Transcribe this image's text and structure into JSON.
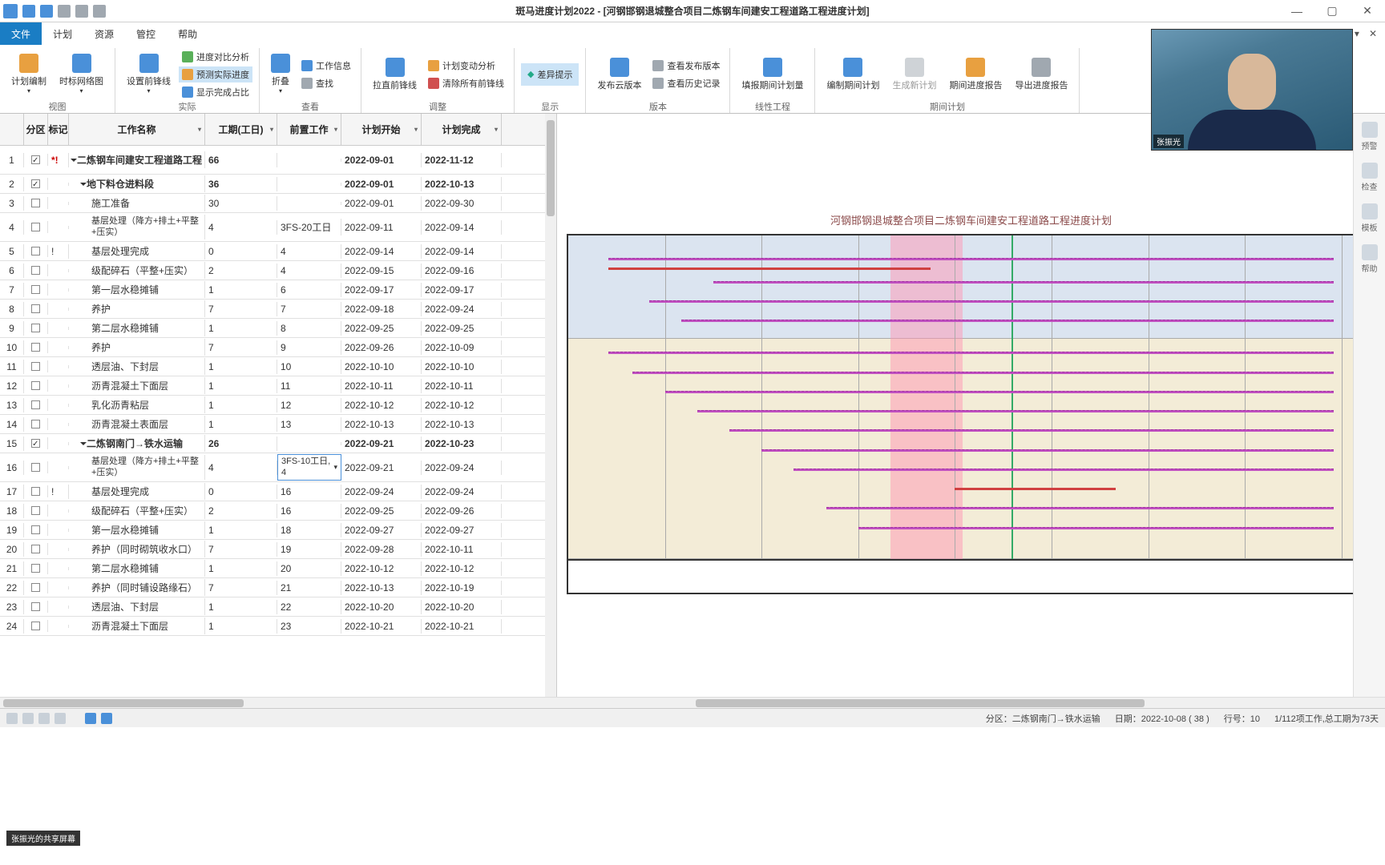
{
  "title": "斑马进度计划2022 - [河钢邯钢退城整合项目二炼钢车间建安工程道路工程进度计划]",
  "menu": {
    "file": "文件",
    "plan": "计划",
    "resource": "资源",
    "control": "管控",
    "help": "帮助"
  },
  "ribbon": {
    "g_view": "视图",
    "g_actual": "实际",
    "g_check": "查看",
    "g_adjust": "调整",
    "g_display": "显示",
    "g_version": "版本",
    "g_line": "线性工程",
    "g_period": "期间计划",
    "plan_edit": "计划编制",
    "network": "时标网络图",
    "front_set": "设置前锋线",
    "compare": "进度对比分析",
    "predict": "预测实际进度",
    "complete_pct": "显示完成占比",
    "collapse": "折叠",
    "work_info": "工作信息",
    "search": "查找",
    "straighten": "拉直前锋线",
    "variance": "计划变动分析",
    "clear_front": "清除所有前锋线",
    "diff_hint": "差异提示",
    "publish": "发布云版本",
    "view_pub": "查看发布版本",
    "view_hist": "查看历史记录",
    "fill_qty": "填报期间计划量",
    "edit_period": "编制期间计划",
    "gen_plan": "生成新计划",
    "period_report": "期间进度报告",
    "export_report": "导出进度报告"
  },
  "cols": {
    "zone": "分区",
    "mark": "标记",
    "name": "工作名称",
    "dur": "工期(工日)",
    "pred": "前置工作",
    "start": "计划开始",
    "end": "计划完成"
  },
  "rows": [
    {
      "n": "1",
      "zone": "on",
      "mark": "*!",
      "mk": true,
      "name": "二炼钢车间建安工程道路工程",
      "dur": "66",
      "pred": "",
      "start": "2022-09-01",
      "end": "2022-11-12",
      "b": true,
      "tall": true,
      "tri": true,
      "ind": 0
    },
    {
      "n": "2",
      "zone": "on",
      "mark": "",
      "name": "地下料仓进料段",
      "dur": "36",
      "pred": "",
      "start": "2022-09-01",
      "end": "2022-10-13",
      "b": true,
      "tri": true,
      "ind": 1
    },
    {
      "n": "3",
      "zone": "",
      "mark": "",
      "name": "施工准备",
      "dur": "30",
      "pred": "",
      "start": "2022-09-01",
      "end": "2022-09-30",
      "ind": 2
    },
    {
      "n": "4",
      "zone": "",
      "mark": "",
      "name": "基层处理（降方+排土+平整+压实）",
      "dur": "4",
      "pred": "3FS-20工日",
      "start": "2022-09-11",
      "end": "2022-09-14",
      "tall": true,
      "wrap": true,
      "ind": 2
    },
    {
      "n": "5",
      "zone": "",
      "mark": "!",
      "name": "基层处理完成",
      "dur": "0",
      "pred": "4",
      "start": "2022-09-14",
      "end": "2022-09-14",
      "ind": 2
    },
    {
      "n": "6",
      "zone": "",
      "mark": "",
      "name": "级配碎石（平整+压实）",
      "dur": "2",
      "pred": "4",
      "start": "2022-09-15",
      "end": "2022-09-16",
      "ind": 2
    },
    {
      "n": "7",
      "zone": "",
      "mark": "",
      "name": "第一层水稳摊铺",
      "dur": "1",
      "pred": "6",
      "start": "2022-09-17",
      "end": "2022-09-17",
      "ind": 2
    },
    {
      "n": "8",
      "zone": "",
      "mark": "",
      "name": "养护",
      "dur": "7",
      "pred": "7",
      "start": "2022-09-18",
      "end": "2022-09-24",
      "ind": 2
    },
    {
      "n": "9",
      "zone": "",
      "mark": "",
      "name": "第二层水稳摊铺",
      "dur": "1",
      "pred": "8",
      "start": "2022-09-25",
      "end": "2022-09-25",
      "ind": 2
    },
    {
      "n": "10",
      "zone": "",
      "mark": "",
      "name": "养护",
      "dur": "7",
      "pred": "9",
      "start": "2022-09-26",
      "end": "2022-10-09",
      "ind": 2
    },
    {
      "n": "11",
      "zone": "",
      "mark": "",
      "name": "透层油、下封层",
      "dur": "1",
      "pred": "10",
      "start": "2022-10-10",
      "end": "2022-10-10",
      "ind": 2
    },
    {
      "n": "12",
      "zone": "",
      "mark": "",
      "name": "沥青混凝土下面层",
      "dur": "1",
      "pred": "11",
      "start": "2022-10-11",
      "end": "2022-10-11",
      "ind": 2
    },
    {
      "n": "13",
      "zone": "",
      "mark": "",
      "name": "乳化沥青粘层",
      "dur": "1",
      "pred": "12",
      "start": "2022-10-12",
      "end": "2022-10-12",
      "ind": 2
    },
    {
      "n": "14",
      "zone": "",
      "mark": "",
      "name": "沥青混凝土表面层",
      "dur": "1",
      "pred": "13",
      "start": "2022-10-13",
      "end": "2022-10-13",
      "ind": 2
    },
    {
      "n": "15",
      "zone": "on",
      "mark": "",
      "name": "二炼钢南门→铁水运输",
      "dur": "26",
      "pred": "",
      "start": "2022-09-21",
      "end": "2022-10-23",
      "b": true,
      "tri": true,
      "ind": 1
    },
    {
      "n": "16",
      "zone": "",
      "mark": "",
      "name": "基层处理（降方+排土+平整+压实）",
      "dur": "4",
      "pred": "3FS-10工日, 4",
      "start": "2022-09-21",
      "end": "2022-09-24",
      "tall": true,
      "wrap": true,
      "ind": 2,
      "edit": true
    },
    {
      "n": "17",
      "zone": "",
      "mark": "!",
      "name": "基层处理完成",
      "dur": "0",
      "pred": "16",
      "start": "2022-09-24",
      "end": "2022-09-24",
      "ind": 2
    },
    {
      "n": "18",
      "zone": "",
      "mark": "",
      "name": "级配碎石（平整+压实）",
      "dur": "2",
      "pred": "16",
      "start": "2022-09-25",
      "end": "2022-09-26",
      "ind": 2
    },
    {
      "n": "19",
      "zone": "",
      "mark": "",
      "name": "第一层水稳摊铺",
      "dur": "1",
      "pred": "18",
      "start": "2022-09-27",
      "end": "2022-09-27",
      "ind": 2
    },
    {
      "n": "20",
      "zone": "",
      "mark": "",
      "name": "养护（同时砌筑收水口）",
      "dur": "7",
      "pred": "19",
      "start": "2022-09-28",
      "end": "2022-10-11",
      "ind": 2
    },
    {
      "n": "21",
      "zone": "",
      "mark": "",
      "name": "第二层水稳摊铺",
      "dur": "1",
      "pred": "20",
      "start": "2022-10-12",
      "end": "2022-10-12",
      "ind": 2
    },
    {
      "n": "22",
      "zone": "",
      "mark": "",
      "name": "养护（同时铺设路缘石）",
      "dur": "7",
      "pred": "21",
      "start": "2022-10-13",
      "end": "2022-10-19",
      "ind": 2
    },
    {
      "n": "23",
      "zone": "",
      "mark": "",
      "name": "透层油、下封层",
      "dur": "1",
      "pred": "22",
      "start": "2022-10-20",
      "end": "2022-10-20",
      "ind": 2
    },
    {
      "n": "24",
      "zone": "",
      "mark": "",
      "name": "沥青混凝土下面层",
      "dur": "1",
      "pred": "23",
      "start": "2022-10-21",
      "end": "2022-10-21",
      "ind": 2
    }
  ],
  "chart_title": "河钢邯钢退城整合项目二炼钢车间建安工程道路工程进度计划",
  "rail": {
    "warn": "预警",
    "check": "检查",
    "tpl": "模板",
    "help": "帮助"
  },
  "status": {
    "zone": "分区：二炼钢南门→铁水运输",
    "date": "日期：2022-10-08 ( 38 )",
    "row": "行号：10",
    "summary": "1/112项工作,总工期为73天"
  },
  "video_name": "张振光",
  "share_tag": "张振光的共享屏幕"
}
